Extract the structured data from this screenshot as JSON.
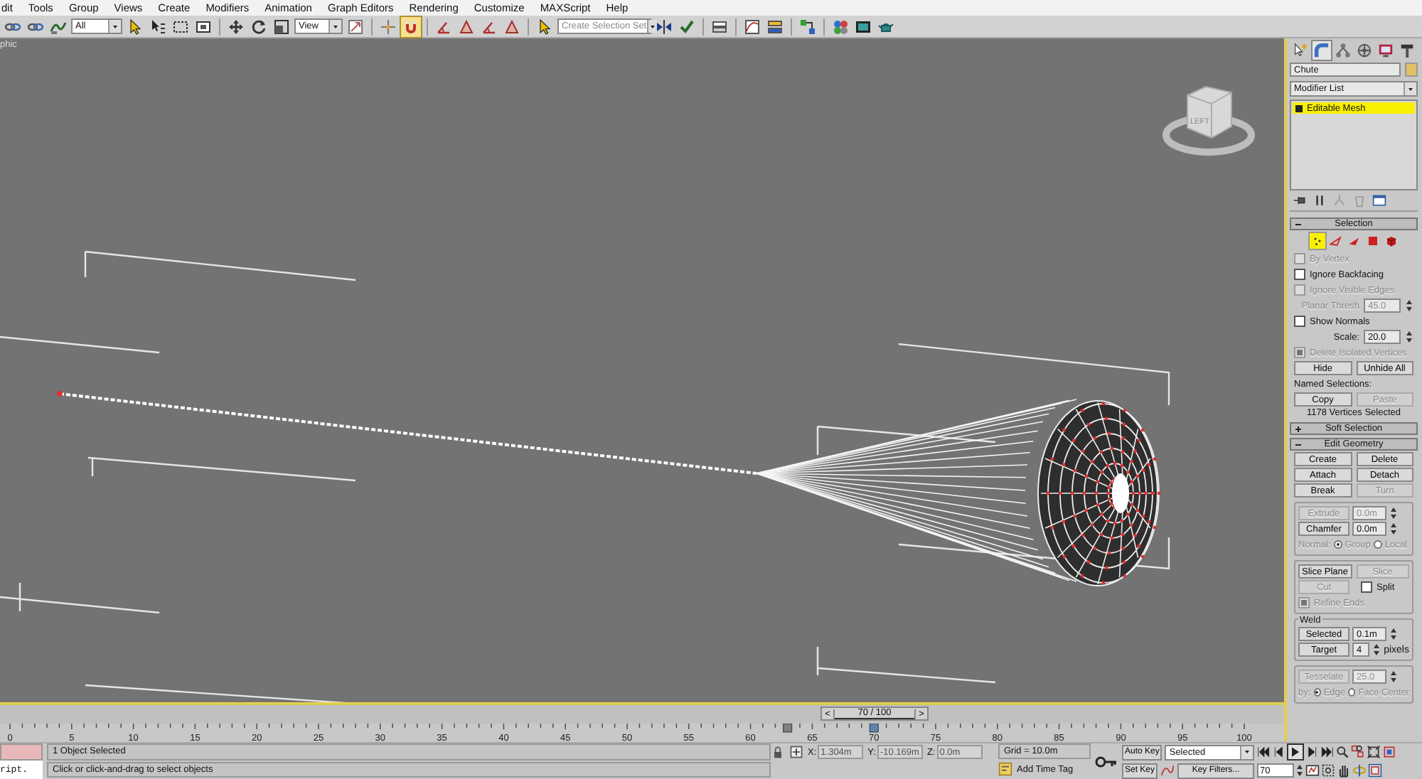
{
  "menu": [
    "dit",
    "Tools",
    "Group",
    "Views",
    "Create",
    "Modifiers",
    "Animation",
    "Graph Editors",
    "Rendering",
    "Customize",
    "MAXScript",
    "Help"
  ],
  "toolbar": {
    "selection_filter": "All",
    "reference_coordinate": "View",
    "named_selection_set": {
      "placeholder": "Create Selection Set"
    }
  },
  "viewport": {
    "label": "phic",
    "view_cube_label": "LEFT"
  },
  "command_panel": {
    "tabs": [
      {
        "selected": false
      },
      {
        "selected": true
      },
      {
        "selected": false
      },
      {
        "selected": false
      },
      {
        "selected": false
      },
      {
        "selected": false
      }
    ],
    "object_name": "Chute",
    "modifier_list": "Modifier List",
    "stack": [
      {
        "label": "Editable Mesh",
        "selected": true
      }
    ],
    "rollouts": [
      {
        "title": "Selection",
        "expanded": true,
        "items": [
          {
            "kind": "levels",
            "levels": [
              {
                "selected": true
              },
              {
                "selected": false
              },
              {
                "selected": false
              },
              {
                "selected": false
              },
              {
                "selected": false
              }
            ]
          },
          {
            "kind": "checkbox",
            "label": "By Vertex",
            "checked": false,
            "disabled": true
          },
          {
            "kind": "checkbox",
            "label": "Ignore Backfacing",
            "checked": false,
            "disabled": false
          },
          {
            "kind": "checkbox",
            "label": "Ignore Visible Edges",
            "checked": false,
            "disabled": true
          },
          {
            "kind": "spinner",
            "label": "Planar Thresh",
            "value": "45.0",
            "disabled": true
          },
          {
            "kind": "checkbox",
            "label": "Show Normals",
            "checked": false,
            "disabled": false
          },
          {
            "kind": "spinner",
            "label": "Scale:",
            "value": "20.0",
            "disabled": false
          },
          {
            "kind": "checkbox",
            "label": "Delete Isolated Vertices",
            "checked": true,
            "disabled": true
          },
          {
            "kind": "buttons",
            "buttons": [
              {
                "label": "Hide",
                "disabled": false
              },
              {
                "label": "Unhide All",
                "disabled": false
              }
            ]
          },
          {
            "kind": "label",
            "text": "Named Selections:"
          },
          {
            "kind": "buttons",
            "buttons": [
              {
                "label": "Copy",
                "disabled": false
              },
              {
                "label": "Paste",
                "disabled": true
              }
            ]
          },
          {
            "kind": "info",
            "text": "1178 Vertices Selected"
          }
        ]
      },
      {
        "title": "Soft Selection",
        "expanded": false
      },
      {
        "title": "Edit Geometry",
        "expanded": true,
        "items": [
          {
            "kind": "buttons",
            "buttons": [
              {
                "label": "Create",
                "disabled": false
              },
              {
                "label": "Delete",
                "disabled": false
              }
            ]
          },
          {
            "kind": "buttons",
            "buttons": [
              {
                "label": "Attach",
                "disabled": false
              },
              {
                "label": "Detach",
                "disabled": false
              }
            ]
          },
          {
            "kind": "buttons",
            "buttons": [
              {
                "label": "Break",
                "disabled": false
              },
              {
                "label": "Turn",
                "disabled": true
              }
            ]
          },
          {
            "kind": "group",
            "items": [
              {
                "kind": "button_spinner",
                "label": "Extrude",
                "value": "0.0m",
                "disabled": true
              },
              {
                "kind": "button_spinner",
                "label": "Chamfer",
                "value": "0.0m",
                "disabled": false
              },
              {
                "kind": "radio",
                "label": "Normal:",
                "disabled": true,
                "options": [
                  {
                    "label": "Group",
                    "selected": true
                  },
                  {
                    "label": "Local",
                    "selected": false
                  }
                ]
              }
            ]
          },
          {
            "kind": "group",
            "items": [
              {
                "kind": "buttons",
                "buttons": [
                  {
                    "label": "Slice Plane",
                    "disabled": false
                  },
                  {
                    "label": "Slice",
                    "disabled": true
                  }
                ]
              },
              {
                "kind": "button_check",
                "label": "Cut",
                "disabled": true,
                "check_label": "Split",
                "checked": false
              },
              {
                "kind": "checkbox",
                "label": "Refine Ends",
                "checked": true,
                "disabled": true
              }
            ]
          },
          {
            "kind": "group",
            "title": "Weld",
            "items": [
              {
                "kind": "button_spinner",
                "label": "Selected",
                "value": "0.1m",
                "disabled": false
              },
              {
                "kind": "button_spinner",
                "label": "Target",
                "value": "4",
                "suffix": "pixels",
                "disabled": false
              }
            ]
          },
          {
            "kind": "group",
            "items": [
              {
                "kind": "button_spinner",
                "label": "Tesselate",
                "value": "25.0",
                "disabled": true
              },
              {
                "kind": "radio",
                "label": "by:",
                "disabled": true,
                "options": [
                  {
                    "label": "Edge",
                    "selected": true
                  },
                  {
                    "label": "Face Center",
                    "selected": false
                  }
                ]
              }
            ]
          }
        ]
      }
    ]
  },
  "time_slider": {
    "prev": "<",
    "label": "70 / 100",
    "next": ">"
  },
  "track_bar": {
    "ticks": [
      "0",
      "5",
      "10",
      "15",
      "20",
      "25",
      "30",
      "35",
      "40",
      "45",
      "50",
      "55",
      "60",
      "65",
      "70",
      "75",
      "80",
      "85",
      "90",
      "95",
      "100"
    ],
    "markers": [
      {
        "kind": "key",
        "level": 0.63
      },
      {
        "kind": "current",
        "level": 0.7
      }
    ]
  },
  "status_bar": {
    "listener_text": "ript.",
    "messages": [
      "1 Object Selected",
      "Click or click-and-drag to select objects"
    ],
    "coordinates": [
      {
        "label": "X:",
        "value": "1.304m"
      },
      {
        "label": "Y:",
        "value": "-10.169m"
      },
      {
        "label": "Z:",
        "value": "0.0m"
      }
    ],
    "grid": "Grid = 10.0m",
    "add_time_tag": "Add Time Tag",
    "auto_key": "Auto Key",
    "key_mode": "Selected",
    "set_key": "Set Key",
    "key_filters": "Key Filters...",
    "current_frame": "70"
  }
}
